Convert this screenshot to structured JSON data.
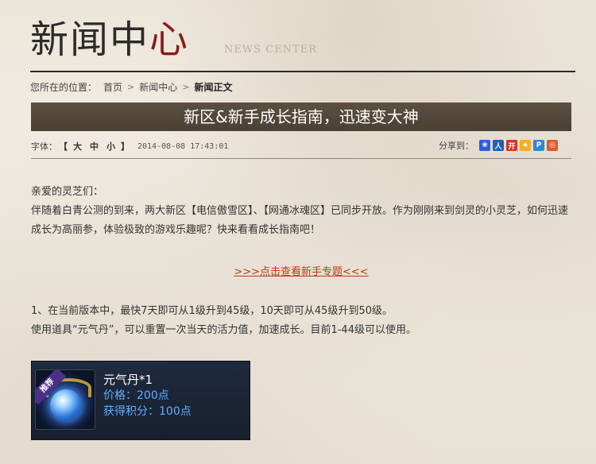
{
  "header": {
    "title_main": "新闻中",
    "title_accent": "心",
    "subtitle": "NEWS CENTER"
  },
  "breadcrumb": {
    "label": "您所在的位置：",
    "items": [
      "首页",
      "新闻中心",
      "新闻正文"
    ]
  },
  "article": {
    "title": "新区&新手成长指南，迅速变大神",
    "font_label": "字体：",
    "font_open": "【",
    "font_close": "】",
    "font_sizes": [
      "大",
      "中",
      "小"
    ],
    "timestamp": "2014-08-08 17:43:01",
    "share_label": "分享到：",
    "share_icons": [
      {
        "name": "baidu-icon",
        "glyph": "❀",
        "color": "#2a5fd8"
      },
      {
        "name": "renren-icon",
        "glyph": "人",
        "color": "#1f5fb5"
      },
      {
        "name": "kaixin-icon",
        "glyph": "开",
        "color": "#d8312a"
      },
      {
        "name": "qzone-icon",
        "glyph": "★",
        "color": "#f0b020"
      },
      {
        "name": "pengyou-icon",
        "glyph": "P",
        "color": "#2a8ad8"
      },
      {
        "name": "weibo-icon",
        "glyph": "◎",
        "color": "#e05a2a"
      }
    ],
    "greeting": "亲爱的灵芝们：",
    "intro": "伴随着白青公测的到来，两大新区【电信傲雪区】、【网通冰魂区】已同步开放。作为刚刚来到剑灵的小灵芝，如何迅速成长为高丽参，体验极致的游戏乐趣呢？快来看看成长指南吧！",
    "topic_link": ">>>点击查看新手专题<<<",
    "point1": "1、在当前版本中，最快7天即可从1级升到45级，10天即可从45级升到50级。",
    "point1_detail": "使用道具“元气丹”，可以重置一次当天的活力值，加速成长。目前1-44级可以使用。"
  },
  "item_card": {
    "badge": "推荐",
    "name": "元气丹*1",
    "price": "价格：200点",
    "points": "获得积分：100点"
  }
}
